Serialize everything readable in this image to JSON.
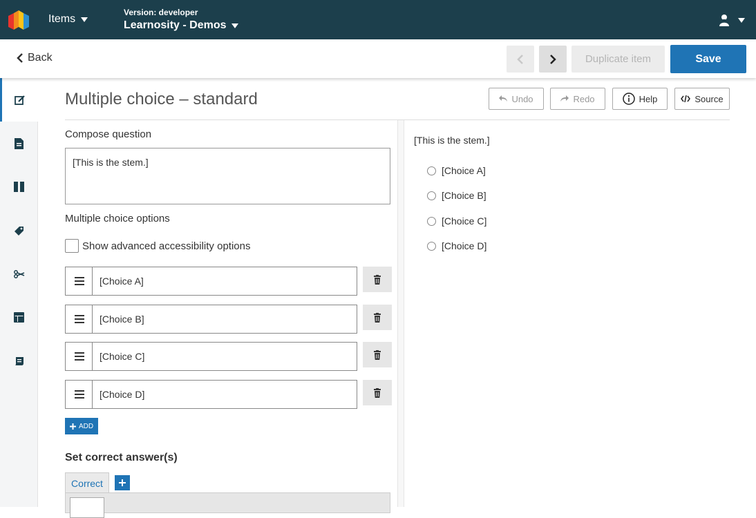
{
  "header": {
    "items_menu": "Items",
    "version_label": "Version: developer",
    "version_value": "Learnosity - Demos"
  },
  "toolbar": {
    "back": "Back",
    "duplicate": "Duplicate item",
    "save": "Save"
  },
  "editor": {
    "title": "Multiple choice – standard",
    "undo": "Undo",
    "redo": "Redo",
    "help": "Help",
    "source": "Source",
    "compose_label": "Compose question",
    "stem": "[This is the stem.]",
    "options_label": "Multiple choice options",
    "accessibility_label": "Show advanced accessibility options",
    "options": [
      "[Choice A]",
      "[Choice B]",
      "[Choice C]",
      "[Choice D]"
    ],
    "add": "ADD",
    "correct_heading": "Set correct answer(s)",
    "correct_tab": "Correct"
  },
  "preview": {
    "stem": "[This is the stem.]",
    "choices": [
      "[Choice A]",
      "[Choice B]",
      "[Choice C]",
      "[Choice D]"
    ]
  },
  "colors": {
    "header_bg": "#1c3f4c",
    "accent": "#1f74b5"
  }
}
